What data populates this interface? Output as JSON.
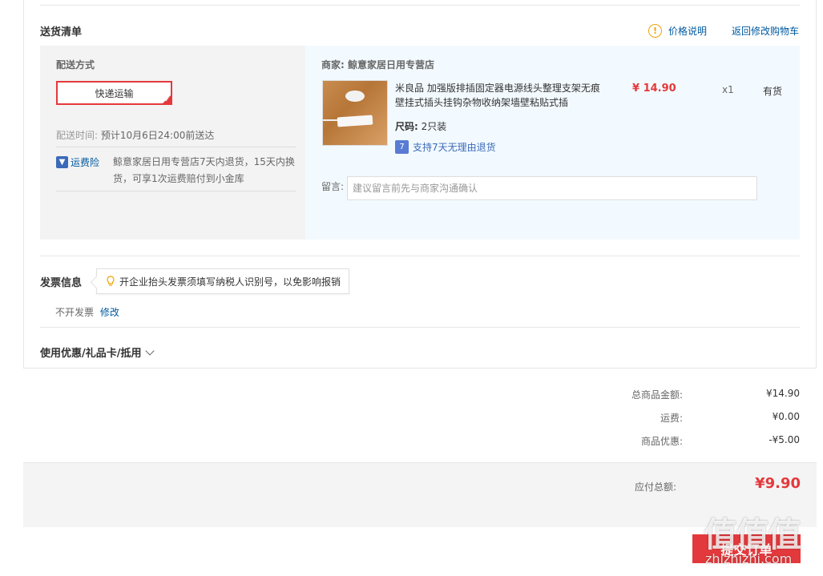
{
  "delivery": {
    "title": "送货清单",
    "price_note": "价格说明",
    "back_to_cart": "返回修改购物车",
    "method_label": "配送方式",
    "method_button": "快递运输",
    "time_label": "配送时间:",
    "time_value": "预计10月6日24:00前送达",
    "insurance_label": "运费险",
    "insurance_text": "鲸意家居日用专营店7天内退货，15天内换货，可享1次运费赔付到小金库",
    "merchant_label": "商家:",
    "merchant_name": "鲸意家居日用专营店",
    "product": {
      "name": "米良品 加强版排插固定器电源线头整理支架无痕壁挂式插头挂钩杂物收纳架墙壁粘贴式插",
      "size_label": "尺码:",
      "size_value": "2只装",
      "return_policy": "支持7天无理由退货",
      "price": "¥ 14.90",
      "qty": "x1",
      "stock": "有货"
    },
    "remark_label": "留言:",
    "remark_placeholder": "建议留言前先与商家沟通确认"
  },
  "invoice": {
    "title": "发票信息",
    "tip": "开企业抬头发票须填写纳税人识别号，以免影响报销",
    "value": "不开发票",
    "edit": "修改"
  },
  "coupon": {
    "label": "使用优惠/礼品卡/抵用"
  },
  "summary": {
    "items": [
      {
        "label": "总商品金额:",
        "value": "¥14.90"
      },
      {
        "label": "运费:",
        "value": "¥0.00"
      },
      {
        "label": "商品优惠:",
        "value": "-¥5.00"
      }
    ],
    "total_label": "应付总额:",
    "total_value": "¥9.90"
  },
  "submit_label": "提交订单",
  "watermark": {
    "big": "值值值",
    "small": "zhizhizhi.com"
  },
  "colors": {
    "accent": "#e4393c",
    "link": "#005aa0",
    "warn": "#f0a30a"
  }
}
